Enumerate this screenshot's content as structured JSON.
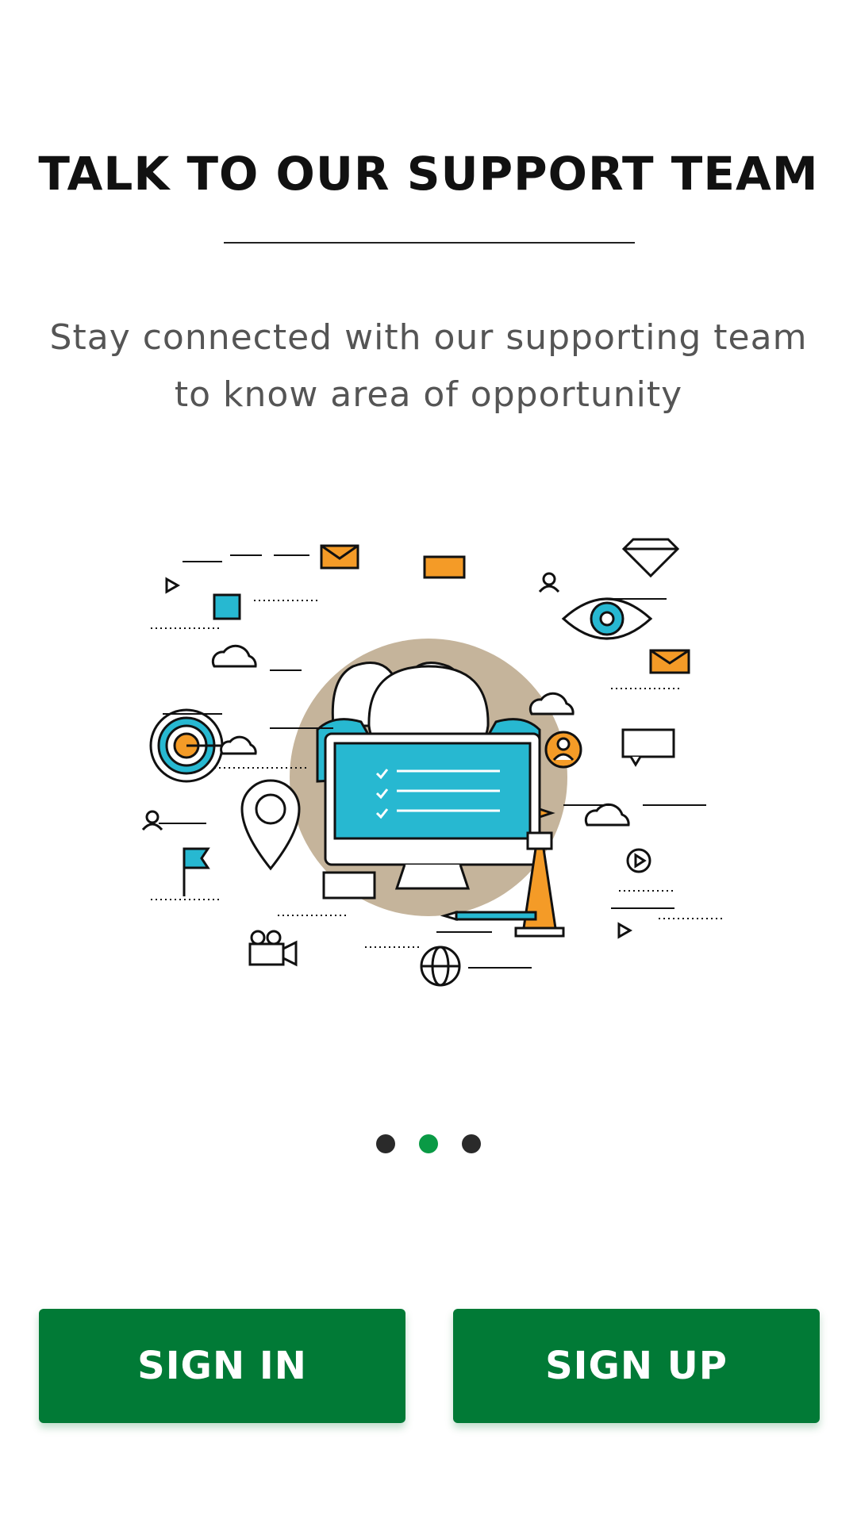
{
  "header": {
    "title": "TALK TO OUR SUPPORT TEAM",
    "subtitle_line1": "Stay connected with our supporting team",
    "subtitle_line2": "to know area of opportunity"
  },
  "illustration": {
    "icons": [
      "person-group-icon",
      "monitor-checklist-icon",
      "eye-icon",
      "target-icon",
      "lighthouse-icon",
      "map-pin-icon",
      "flag-icon",
      "cloud-icon",
      "envelope-icon",
      "diamond-icon",
      "globe-icon",
      "camera-icon",
      "chat-bubble-icon",
      "pencil-icon",
      "play-icon",
      "user-icon"
    ]
  },
  "pager": {
    "count": 3,
    "active_index": 1
  },
  "actions": {
    "sign_in_label": "SIGN IN",
    "sign_up_label": "SIGN UP"
  },
  "colors": {
    "accent": "#017a36",
    "active_dot": "#0a9a45",
    "teal": "#27b8d1",
    "orange": "#f49b27",
    "beige": "#c5b49b"
  }
}
